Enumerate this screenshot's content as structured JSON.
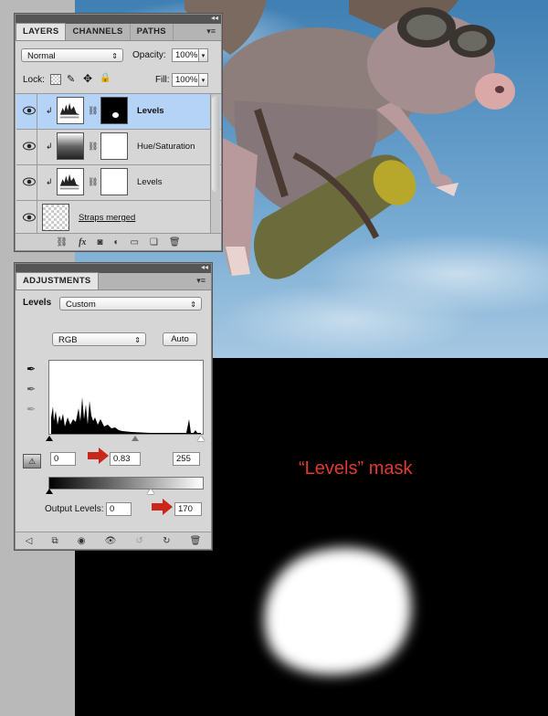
{
  "layers_panel": {
    "tabs": [
      {
        "label": "LAYERS",
        "active": true
      },
      {
        "label": "CHANNELS",
        "active": false
      },
      {
        "label": "PATHS",
        "active": false
      }
    ],
    "blend_mode": "Normal",
    "opacity_label": "Opacity:",
    "opacity_value": "100%",
    "lock_label": "Lock:",
    "fill_label": "Fill:",
    "fill_value": "100%",
    "layers": [
      {
        "name": "Levels",
        "selected": true,
        "has_mask": true
      },
      {
        "name": "Hue/Saturation",
        "selected": false,
        "has_mask": true
      },
      {
        "name": "Levels",
        "selected": false,
        "has_mask": true
      },
      {
        "name": "Straps merged",
        "selected": false,
        "has_mask": false
      }
    ]
  },
  "adjustments_panel": {
    "title": "ADJUSTMENTS",
    "type_label": "Levels",
    "preset": "Custom",
    "channel": "RGB",
    "auto_label": "Auto",
    "input_black": "0",
    "input_gamma": "0.83",
    "input_white": "255",
    "output_label": "Output Levels:",
    "output_black": "0",
    "output_white": "170"
  },
  "annotation": {
    "mask_label": "“Levels” mask",
    "accent_color": "#c9271c"
  }
}
